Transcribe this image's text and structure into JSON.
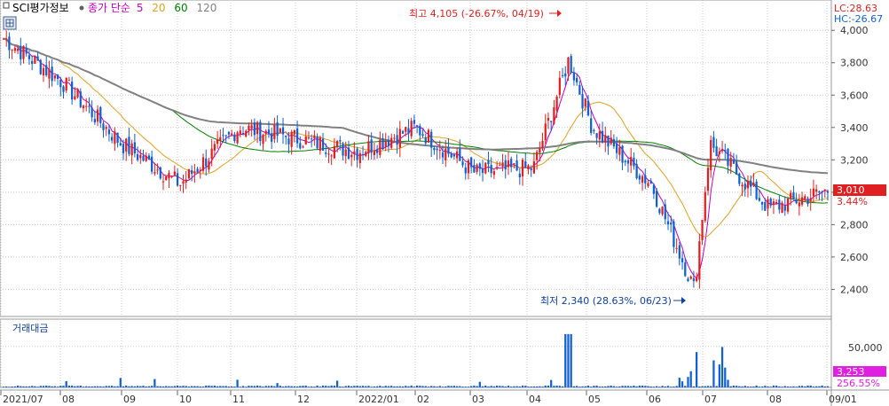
{
  "chart_data": [
    {
      "type": "candlestick",
      "title": "SCI평가정보",
      "legend": {
        "label": "종가 단순",
        "periods": [
          "5",
          "20",
          "60",
          "120"
        ],
        "colors": [
          "#c000c0",
          "#e0a020",
          "#008000",
          "#808080"
        ]
      },
      "right_info": {
        "lc": "LC:28.63",
        "hc": "HC:-26.67"
      },
      "price_axis": {
        "ylim": [
          2260,
          4160
        ],
        "ticks": [
          "2,400",
          "2,600",
          "2,800",
          "3,000",
          "3,200",
          "3,400",
          "3,600",
          "3,800",
          "4,000"
        ],
        "tick_values": [
          2400,
          2600,
          2800,
          3000,
          3200,
          3400,
          3600,
          3800,
          4000
        ]
      },
      "current": {
        "price": "3,010",
        "change": "3.44%",
        "value": 3010
      },
      "annotations": {
        "high": {
          "text": "최고 4,105 (-26.67%, 04/19)",
          "date": "2022-04-19",
          "value": 4105
        },
        "low": {
          "text": "최저 2,340 (28.63%, 06/23)",
          "date": "2022-06-23",
          "value": 2340
        }
      },
      "x_ticks": [
        "2021/07",
        "08",
        "09",
        "10",
        "11",
        "12",
        "2022/01",
        "02",
        "03",
        "04",
        "05",
        "06",
        "07",
        "08",
        "09/01"
      ],
      "close_series": {
        "x": [
          "2021-07",
          "2021-08",
          "2021-09",
          "2021-10",
          "2021-11",
          "2021-12",
          "2022-01",
          "2022-02",
          "2022-03",
          "2022-04",
          "2022-04-19",
          "2022-05",
          "2022-06",
          "2022-06-23",
          "2022-07",
          "2022-08",
          "2022-09-01"
        ],
        "values": [
          3950,
          3680,
          3300,
          3050,
          3400,
          3330,
          3250,
          3400,
          3120,
          3150,
          3820,
          3400,
          3050,
          2400,
          3300,
          2900,
          3010
        ]
      },
      "colors": {
        "up": "#e02020",
        "down": "#1060d0"
      }
    },
    {
      "type": "bar",
      "title": "거래대금",
      "yaxis": {
        "ticks": [
          "50,000"
        ],
        "tick_values": [
          50000
        ],
        "ylim": [
          0,
          80000
        ]
      },
      "current": {
        "value": "3,253",
        "change": "256.55%"
      },
      "color": "#1060d0"
    }
  ]
}
